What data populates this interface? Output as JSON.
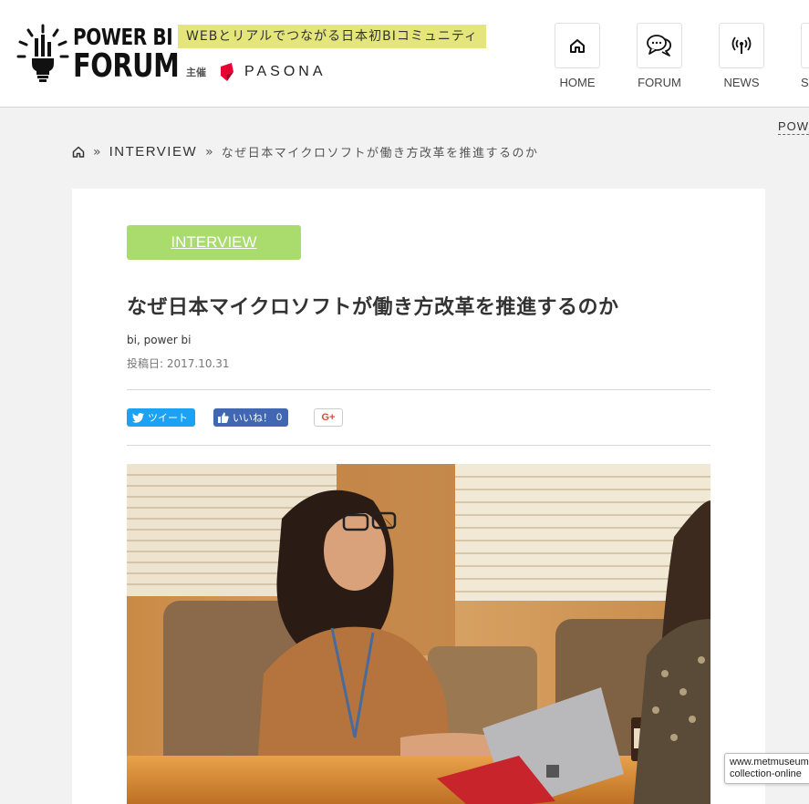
{
  "header": {
    "logo": {
      "line1": "POWER BI",
      "line2": "FORUM"
    },
    "tagline": "WEBとリアルでつながる日本初BIコミュニティ",
    "host_label": "主催",
    "host_name": "PASONA"
  },
  "nav": [
    {
      "label": "HOME",
      "icon": "home-icon"
    },
    {
      "label": "FORUM",
      "icon": "chat-bubbles-icon"
    },
    {
      "label": "NEWS",
      "icon": "broadcast-icon"
    },
    {
      "label": "SPECI",
      "icon": ""
    }
  ],
  "side_link": "POW",
  "breadcrumb": {
    "home_icon": "home-icon",
    "separator": "»",
    "category": "INTERVIEW",
    "current": "なぜ日本マイクロソフトが働き方改革を推進するのか"
  },
  "article": {
    "category": "INTERVIEW",
    "category_color": "#a9dc6c",
    "title": "なぜ日本マイクロソフトが働き方改革を推進するのか",
    "tags": [
      "bi",
      "power bi"
    ],
    "tag_separator": ",",
    "date_label": "投稿日: 2017.10.31",
    "share": {
      "tweet": "ツイート",
      "like": "いいね！",
      "like_count": "0",
      "gplus": "G+"
    }
  },
  "url_tooltip": {
    "line1": "www.metmuseum",
    "line2": "collection-online"
  },
  "colors": {
    "accent_green": "#a9dc6c",
    "tagline_bg": "#e4e57a",
    "twitter": "#1da1f2",
    "facebook": "#4267b2",
    "pasona_red": "#e60033"
  }
}
